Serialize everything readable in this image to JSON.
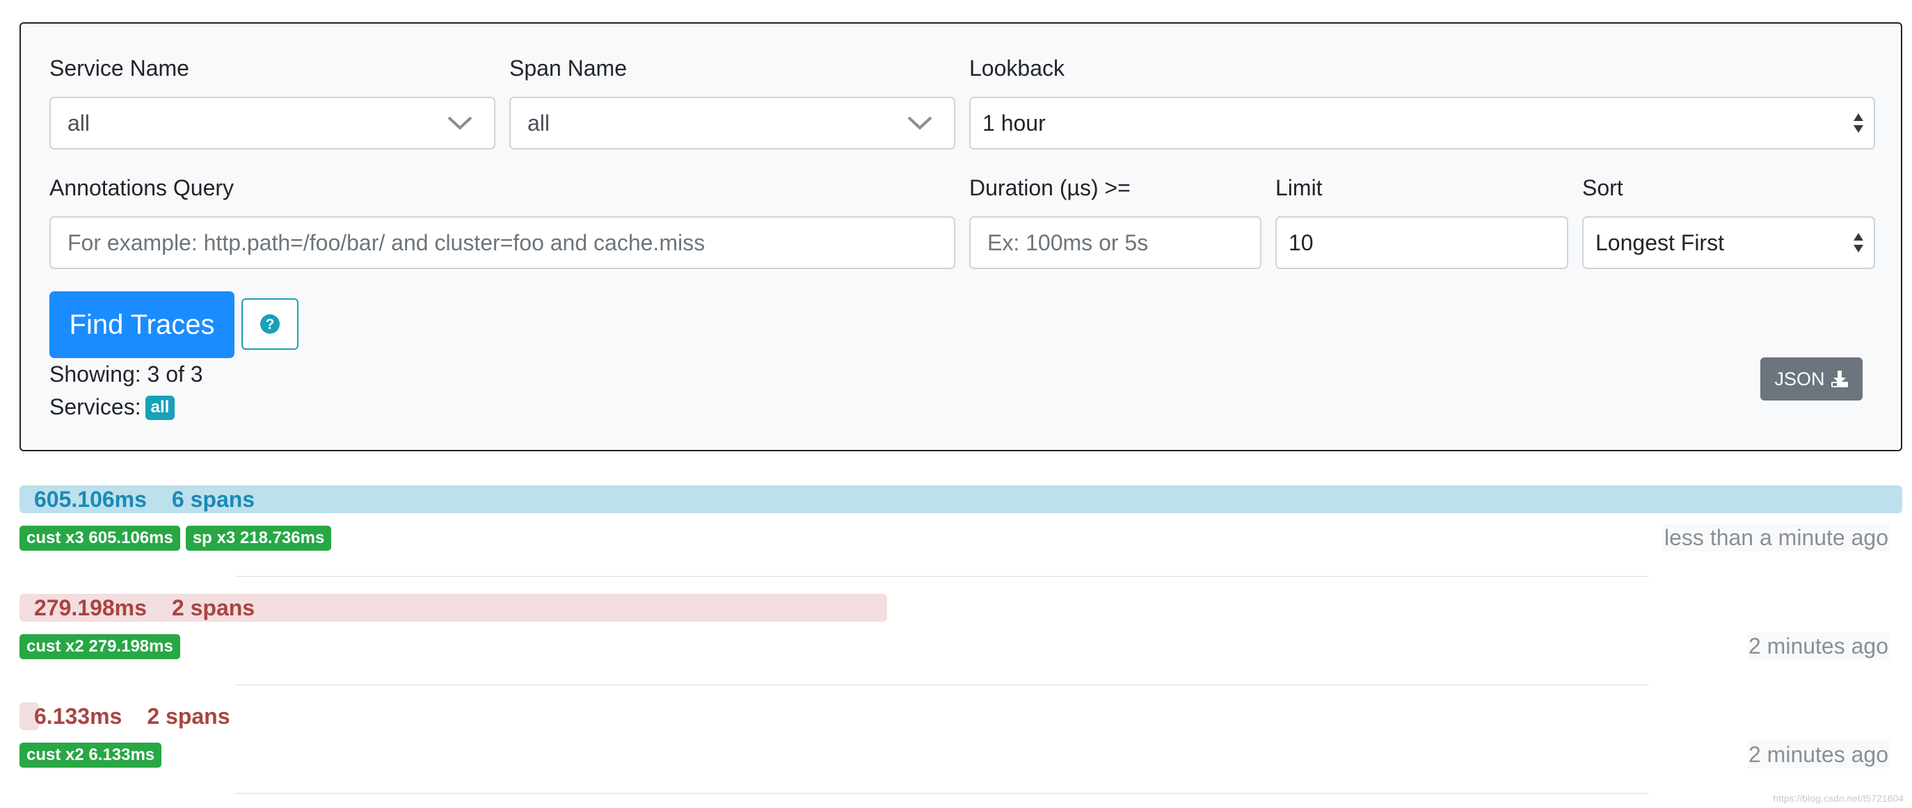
{
  "search": {
    "service_name_label": "Service Name",
    "service_name_value": "all",
    "span_name_label": "Span Name",
    "span_name_value": "all",
    "lookback_label": "Lookback",
    "lookback_value": "1 hour",
    "annotations_label": "Annotations Query",
    "annotations_placeholder": "For example: http.path=/foo/bar/ and cluster=foo and cache.miss",
    "duration_label": "Duration (µs) >=",
    "duration_placeholder": "Ex: 100ms or 5s",
    "limit_label": "Limit",
    "limit_value": "10",
    "sort_label": "Sort",
    "sort_value": "Longest First",
    "find_button": "Find Traces",
    "showing_text": "Showing: 3 of 3",
    "services_label": "Services:",
    "services_badge": "all",
    "json_button": "JSON"
  },
  "traces": [
    {
      "duration": "605.106ms",
      "spans": "6 spans",
      "bar_fraction": 1.0,
      "bar_color": "#bde0ed",
      "text_color": "#1a8ab5",
      "badges": [
        "cust x3 605.106ms",
        "sp x3 218.736ms"
      ],
      "time_ago": "less than a minute ago"
    },
    {
      "duration": "279.198ms",
      "spans": "2 spans",
      "bar_fraction": 0.461,
      "bar_color": "#f2dedf",
      "text_color": "#a94442",
      "badges": [
        "cust x2 279.198ms"
      ],
      "time_ago": "2 minutes ago"
    },
    {
      "duration": "6.133ms",
      "spans": "2 spans",
      "bar_fraction": 0.0101,
      "bar_color": "#f2dedf",
      "text_color": "#a94442",
      "badges": [
        "cust x2 6.133ms"
      ],
      "time_ago": "2 minutes ago"
    }
  ],
  "watermark": "https://blog.csdn.net/t5721604",
  "colors": {
    "primary": "#1a8cff",
    "info": "#17a2b8",
    "success": "#28a745",
    "secondary": "#6c757d"
  }
}
